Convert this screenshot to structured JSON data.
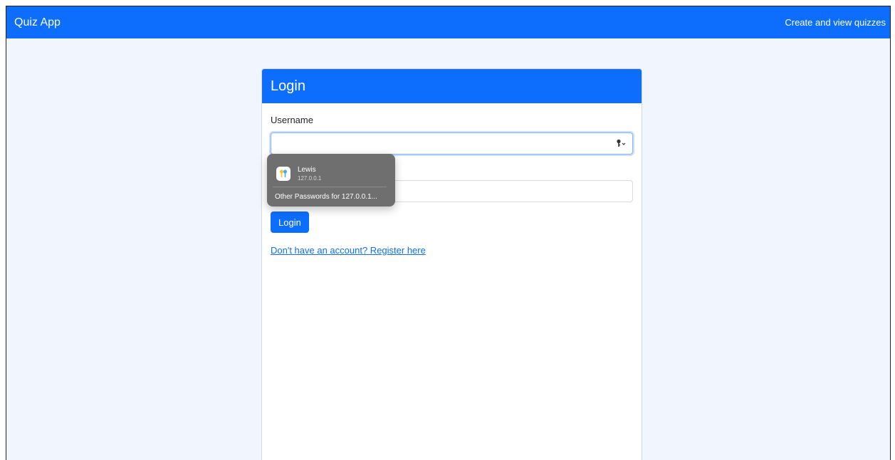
{
  "navbar": {
    "brand": "Quiz App",
    "link": "Create and view quizzes",
    "color": "#0d6efd"
  },
  "card": {
    "title": "Login",
    "username_label": "Username",
    "username_value": "",
    "password_label": "",
    "password_value": "",
    "submit_label": "Login",
    "register_link": "Don't have an account? Register here"
  },
  "autofill": {
    "icon": "passwords-app-icon",
    "user": "Lewis",
    "host": "127.0.0.1",
    "other": "Other Passwords for 127.0.0.1..."
  },
  "colors": {
    "page_bg": "#f0f5fe",
    "accent": "#0d6efd",
    "popup_bg": "#6f6f6f"
  }
}
